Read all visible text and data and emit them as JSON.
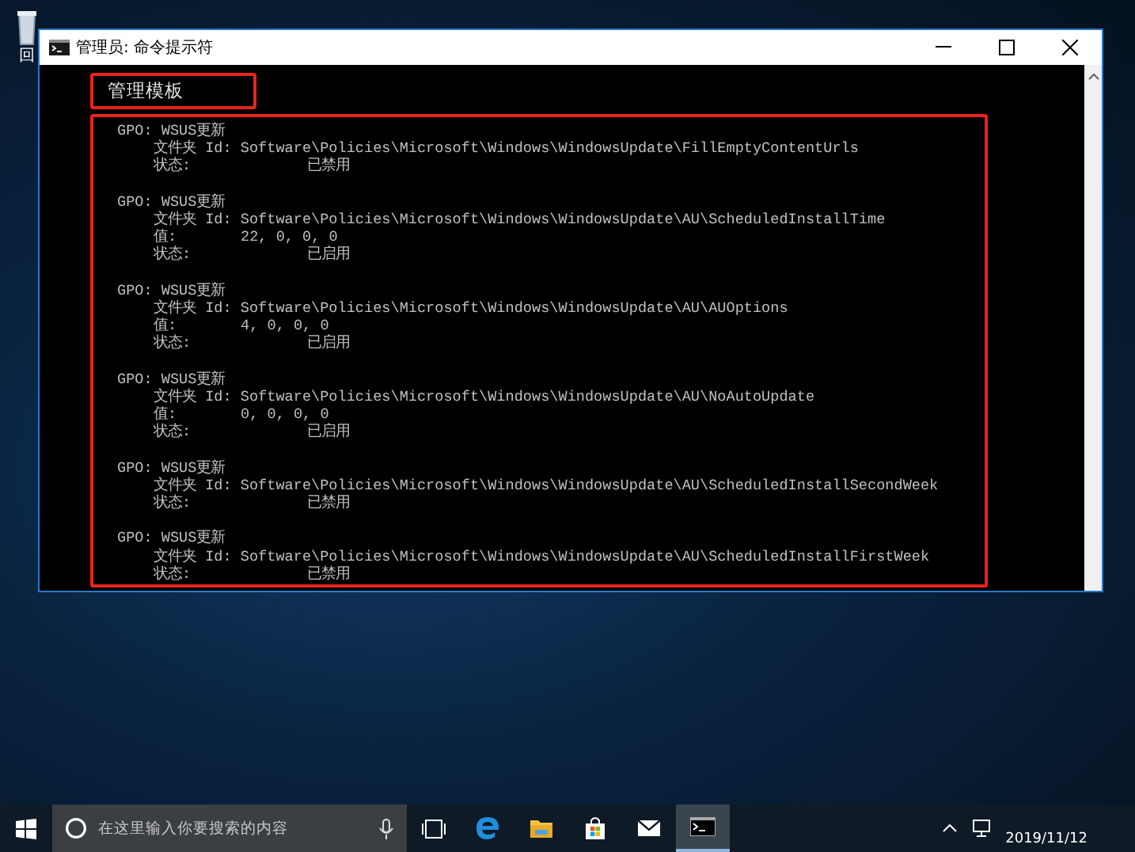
{
  "desktop": {
    "icons": [
      {
        "label": "回"
      }
    ]
  },
  "window": {
    "title": "管理员: 命令提示符",
    "console": {
      "heading": "管理模板",
      "entries": [
        {
          "gpo": "GPO: WSUS更新",
          "folder": "文件夹 Id: Software\\Policies\\Microsoft\\Windows\\WindowsUpdate\\FillEmptyContentUrls",
          "rows": [
            {
              "kind": "state",
              "label": "状态:",
              "text": "已禁用"
            }
          ]
        },
        {
          "gpo": "GPO: WSUS更新",
          "folder": "文件夹 Id: Software\\Policies\\Microsoft\\Windows\\WindowsUpdate\\AU\\ScheduledInstallTime",
          "rows": [
            {
              "kind": "value",
              "label": "值:",
              "text": "22, 0, 0, 0"
            },
            {
              "kind": "state",
              "label": "状态:",
              "text": "已启用"
            }
          ]
        },
        {
          "gpo": "GPO: WSUS更新",
          "folder": "文件夹 Id: Software\\Policies\\Microsoft\\Windows\\WindowsUpdate\\AU\\AUOptions",
          "rows": [
            {
              "kind": "value",
              "label": "值:",
              "text": "4, 0, 0, 0"
            },
            {
              "kind": "state",
              "label": "状态:",
              "text": "已启用"
            }
          ]
        },
        {
          "gpo": "GPO: WSUS更新",
          "folder": "文件夹 Id: Software\\Policies\\Microsoft\\Windows\\WindowsUpdate\\AU\\NoAutoUpdate",
          "rows": [
            {
              "kind": "value",
              "label": "值:",
              "text": "0, 0, 0, 0"
            },
            {
              "kind": "state",
              "label": "状态:",
              "text": "已启用"
            }
          ]
        },
        {
          "gpo": "GPO: WSUS更新",
          "folder": "文件夹 Id: Software\\Policies\\Microsoft\\Windows\\WindowsUpdate\\AU\\ScheduledInstallSecondWeek",
          "rows": [
            {
              "kind": "state",
              "label": "状态:",
              "text": "已禁用"
            }
          ]
        },
        {
          "gpo": "GPO: WSUS更新",
          "folder": "文件夹 Id: Software\\Policies\\Microsoft\\Windows\\WindowsUpdate\\AU\\ScheduledInstallFirstWeek",
          "rows": [
            {
              "kind": "state",
              "label": "状态:",
              "text": "已禁用"
            }
          ]
        }
      ]
    }
  },
  "taskbar": {
    "search": {
      "placeholder": "在这里输入你要搜索的内容"
    },
    "apps": [
      {
        "kind": "taskview",
        "selected": false
      },
      {
        "kind": "browser",
        "selected": false
      },
      {
        "kind": "folder",
        "selected": false
      },
      {
        "kind": "store",
        "selected": false
      },
      {
        "kind": "mail",
        "selected": false
      },
      {
        "kind": "terminal",
        "selected": true
      }
    ],
    "clock": {
      "date": "2019/11/12"
    }
  }
}
